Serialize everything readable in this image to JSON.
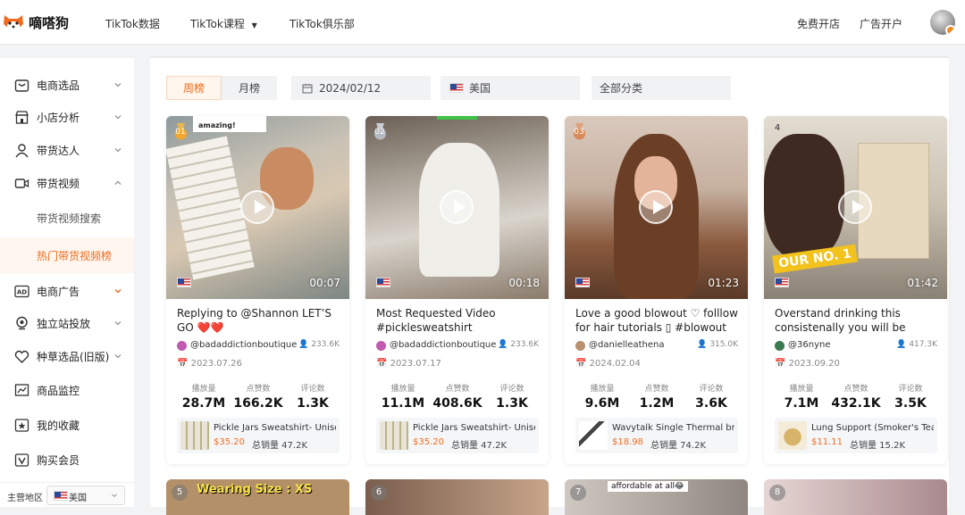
{
  "app": {
    "name": "嘀嗒狗"
  },
  "nav": {
    "items": [
      "TikTok数据",
      "TikTok课程",
      "TikTok俱乐部"
    ],
    "right": [
      "免费开店",
      "广告开户"
    ]
  },
  "sidebar": {
    "items": [
      {
        "label": "电商选品",
        "icon": "store-icon"
      },
      {
        "label": "小店分析",
        "icon": "shop-icon"
      },
      {
        "label": "带货达人",
        "icon": "person-icon"
      },
      {
        "label": "带货视频",
        "icon": "video-icon"
      },
      {
        "label": "带货视频搜索"
      },
      {
        "label": "热门带货视频榜"
      },
      {
        "label": "电商广告",
        "icon": "ad-icon"
      },
      {
        "label": "独立站投放",
        "icon": "location-icon"
      },
      {
        "label": "种草选品(旧版)",
        "icon": "heart-icon"
      },
      {
        "label": "商品监控",
        "icon": "chart-icon"
      },
      {
        "label": "我的收藏",
        "icon": "star-icon"
      },
      {
        "label": "购买会员",
        "icon": "vip-icon"
      }
    ],
    "region_label": "主营地区",
    "region_value": "美国"
  },
  "filters": {
    "tabs": [
      "周榜",
      "月榜"
    ],
    "active_tab": "周榜",
    "date": "2024/02/12",
    "country": "美国",
    "category": "全部分类"
  },
  "colors": {
    "accent": "#f26b1d"
  },
  "cards": [
    {
      "rank": "01",
      "duration": "00:07",
      "title": "Replying to @Shannon LET’S GO ❤️❤️#badaddictionboutique #pi...",
      "author": "@badaddictionboutique",
      "followers": "233.6K",
      "date": "2023.07.26",
      "stat_labels": [
        "播放量",
        "点赞数",
        "评论数"
      ],
      "stats": [
        "28.7M",
        "166.2K",
        "1.3K"
      ],
      "product_name": "Pickle Jars Sweatshirt- Unisex...",
      "price": "$35.20",
      "sales": "总销量 47.2K"
    },
    {
      "rank": "02",
      "duration": "00:18",
      "title": "Most Requested Video #picklesweatshirt #badaddictionboutique #pi...",
      "author": "@badaddictionboutique",
      "followers": "233.6K",
      "date": "2023.07.17",
      "stat_labels": [
        "播放量",
        "点赞数",
        "评论数"
      ],
      "stats": [
        "11.1M",
        "408.6K",
        "1.3K"
      ],
      "product_name": "Pickle Jars Sweatshirt- Unisex...",
      "price": "$35.20",
      "sales": "总销量 47.2K"
    },
    {
      "rank": "03",
      "duration": "01:23",
      "title": "Love a good blowout ♡ folllow for hair tutorials ▯ #blowout #blowo...",
      "author": "@danielleathena",
      "followers": "315.0K",
      "date": "2024.02.04",
      "stat_labels": [
        "播放量",
        "点赞数",
        "评论数"
      ],
      "stats": [
        "9.6M",
        "1.2M",
        "3.6K"
      ],
      "product_name": "Wavytalk Single Thermal brus...",
      "price": "$18.98",
      "sales": "总销量 74.2K"
    },
    {
      "rank": "4",
      "duration": "01:42",
      "title": "Overstand drinking this consistenally you will be changing your life fo...",
      "author": "@36nyne",
      "followers": "417.3K",
      "date": "2023.09.20",
      "stat_labels": [
        "播放量",
        "点赞数",
        "评论数"
      ],
      "stats": [
        "7.1M",
        "432.1K",
        "3.5K"
      ],
      "product_name": "Lung Support (Smoker's Tea/...",
      "price": "$11.11",
      "sales": "总销量 15.2K"
    }
  ],
  "next_row": [
    {
      "rank": "5",
      "caption": "Wearing Size : XS"
    },
    {
      "rank": "6",
      "caption": ""
    },
    {
      "rank": "7",
      "caption": "affordable at all😂"
    },
    {
      "rank": "8",
      "caption": ""
    }
  ]
}
